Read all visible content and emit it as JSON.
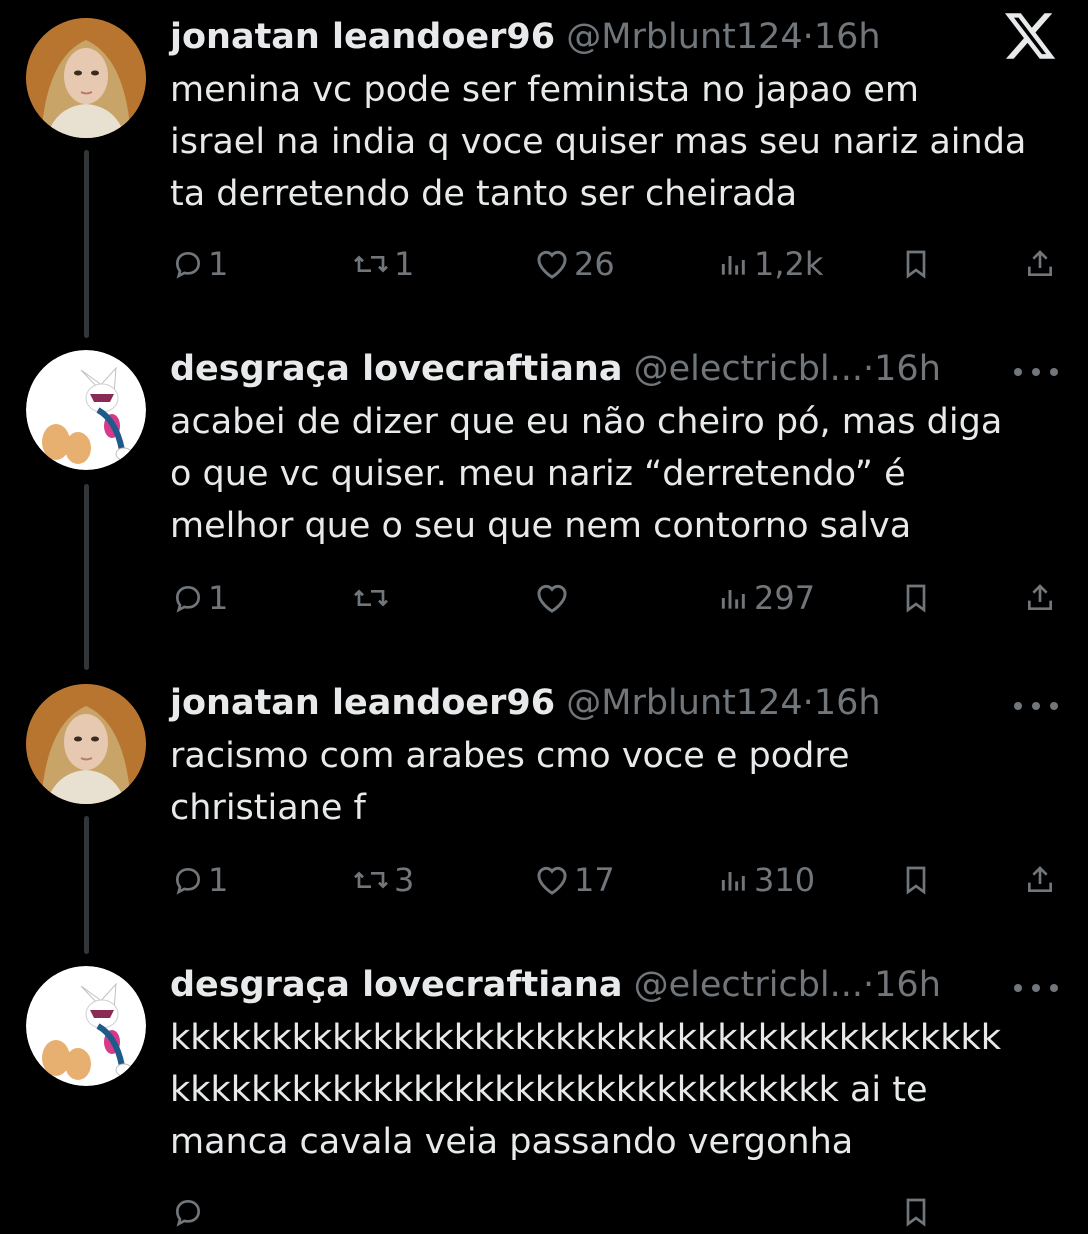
{
  "app": {
    "logo_icon": "x-logo-icon"
  },
  "tweets": [
    {
      "name": "jonatan leandoer96",
      "handle": "@Mrblunt124",
      "separator": "·",
      "time": "16h",
      "lines": [
        "menina vc pode ser feminista no japao em",
        "israel na india q voce quiser mas seu nariz ainda",
        "ta derretendo de tanto ser cheirada"
      ],
      "replies": "1",
      "reposts": "1",
      "likes": "26",
      "views": "1,2k"
    },
    {
      "name": "desgraça lovecraftiana",
      "handle": "@electricbl...",
      "separator": "·",
      "time": "16h",
      "lines": [
        "acabei de dizer que eu não cheiro pó, mas diga",
        "o que vc quiser. meu nariz “derretendo” é",
        "melhor que o seu que nem contorno salva"
      ],
      "replies": "1",
      "reposts": "",
      "likes": "",
      "views": "297"
    },
    {
      "name": "jonatan leandoer96",
      "handle": "@Mrblunt124",
      "separator": "·",
      "time": "16h",
      "lines": [
        "racismo com arabes cmo voce e podre",
        "christiane f"
      ],
      "replies": "1",
      "reposts": "3",
      "likes": "17",
      "views": "310"
    },
    {
      "name": "desgraça lovecraftiana",
      "handle": "@electricbl...",
      "separator": "·",
      "time": "16h",
      "lines": [
        "kkkkkkkkkkkkkkkkkkkkkkkkkkkkkkkkkkkkkkkkk",
        "kkkkkkkkkkkkkkkkkkkkkkkkkkkkkkkkk ai te",
        "manca cavala veia passando vergonha"
      ],
      "replies": "",
      "reposts": "",
      "likes": "",
      "views": ""
    }
  ],
  "colors": {
    "background": "#000000",
    "primary_text": "#e7e9ea",
    "secondary_text": "#71767b",
    "thread_line": "#333639"
  }
}
